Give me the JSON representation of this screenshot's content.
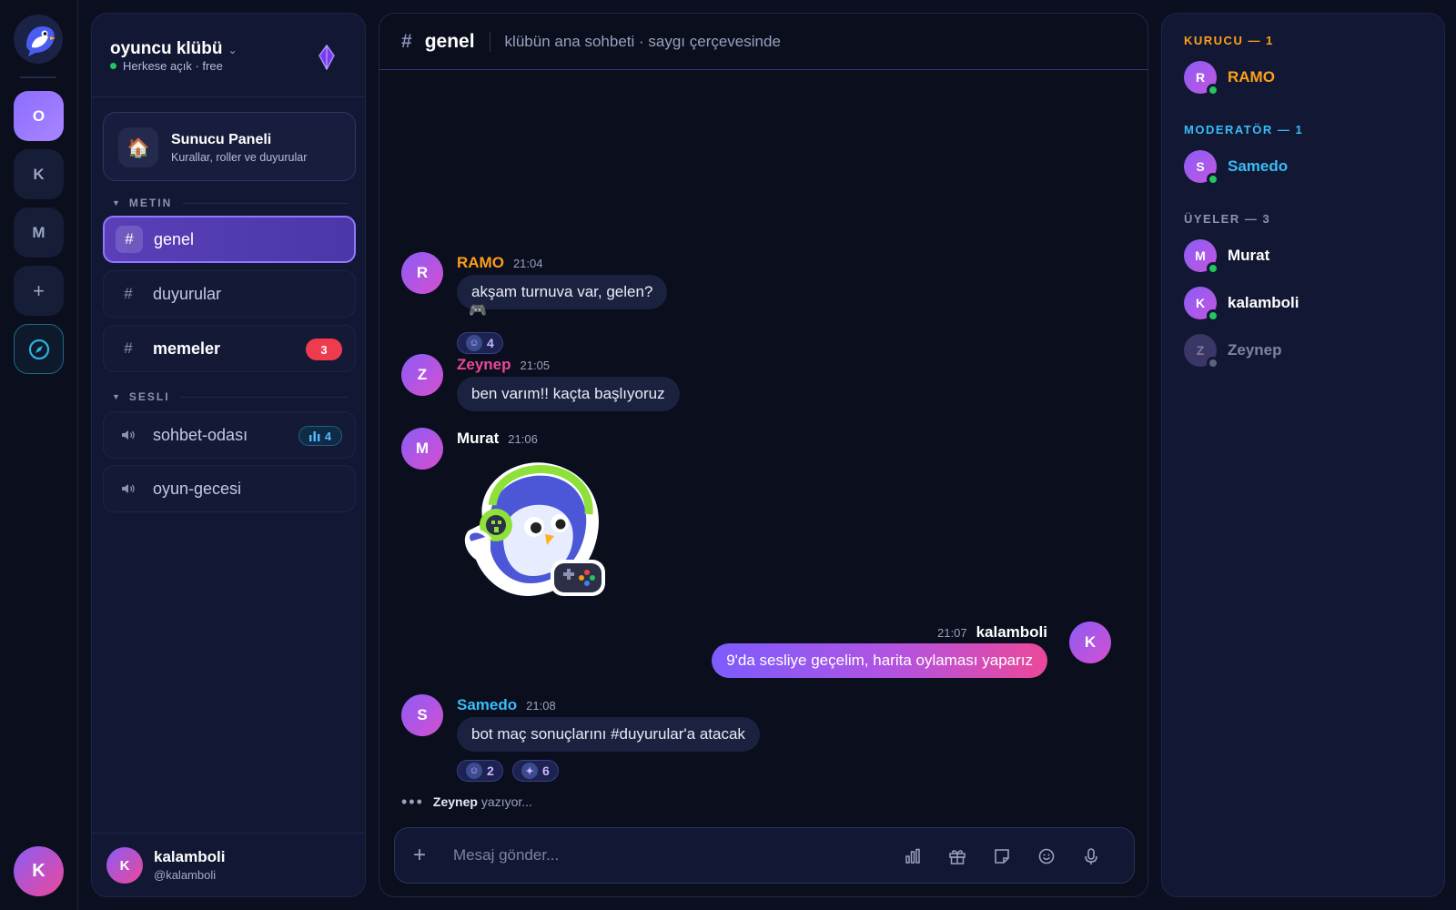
{
  "rail": {
    "servers": [
      {
        "label": "O",
        "active": true
      },
      {
        "label": "K",
        "active": false
      },
      {
        "label": "M",
        "active": false
      }
    ],
    "add_label": "+",
    "user_initial": "K"
  },
  "server": {
    "name": "oyuncu klübü",
    "status": "Herkese açık · free"
  },
  "panel_card": {
    "icon": "🏠",
    "title": "Sunucu Paneli",
    "subtitle": "Kurallar, roller ve duyurular"
  },
  "categories": {
    "text": "METIN",
    "voice": "SESLI"
  },
  "text_channels": [
    {
      "name": "genel",
      "active": true
    },
    {
      "name": "duyurular",
      "active": false
    },
    {
      "name": "memeler",
      "active": false,
      "unread": "3"
    }
  ],
  "voice_channels": [
    {
      "name": "sohbet-odası",
      "count": "4"
    },
    {
      "name": "oyun-gecesi"
    }
  ],
  "user": {
    "initial": "K",
    "name": "kalamboli",
    "handle": "@kalamboli"
  },
  "chat": {
    "hash": "#",
    "channel": "genel",
    "topic": "klübün ana sohbeti · saygı çerçevesinde",
    "messages": [
      {
        "initial": "R",
        "user": "RAMO",
        "time": "21:04",
        "text": "akşam turnuva var, gelen?",
        "emoji": "🎮",
        "reactions": [
          {
            "icon": "sticker-icon",
            "count": "4"
          }
        ],
        "color": "#ff9f1a"
      },
      {
        "initial": "Z",
        "user": "Zeynep",
        "time": "21:05",
        "text": "ben varım!! kaçta başlıyoruz",
        "color": "#ec4899"
      },
      {
        "initial": "M",
        "user": "Murat",
        "time": "21:06",
        "sticker": "gamer-bird-sticker",
        "color": "#ffffff"
      },
      {
        "initial": "K",
        "user": "kalamboli",
        "time": "21:07",
        "text": "9'da sesliye geçelim, harita oylaması yaparız",
        "color": "#ffffff"
      },
      {
        "initial": "S",
        "user": "Samedo",
        "time": "21:08",
        "text": "bot maç sonuçlarını #duyurular'a atacak",
        "reactions": [
          {
            "icon": "sticker-icon",
            "count": "2"
          },
          {
            "icon": "bird-icon",
            "count": "6"
          }
        ],
        "color": "#38bdf8"
      }
    ],
    "typing_user": "Zeynep",
    "typing_text": "yazıyor..."
  },
  "composer": {
    "placeholder": "Mesaj gönder...",
    "tools": [
      "poll-icon",
      "gift-icon",
      "sticker-icon",
      "emoji-icon",
      "mic-icon"
    ]
  },
  "members": {
    "groups": [
      {
        "title": "KURUCU — 1",
        "color": "#ff9f1a",
        "people": [
          {
            "initial": "R",
            "name": "RAMO",
            "online": true
          }
        ]
      },
      {
        "title": "MODERATÖR — 1",
        "color": "#38bdf8",
        "people": [
          {
            "initial": "S",
            "name": "Samedo",
            "online": true
          }
        ]
      },
      {
        "title": "ÜYELER — 3",
        "color": "#8a93b5",
        "people": [
          {
            "initial": "M",
            "name": "Murat",
            "online": true
          },
          {
            "initial": "K",
            "name": "kalamboli",
            "online": true
          },
          {
            "initial": "Z",
            "name": "Zeynep",
            "online": false
          }
        ]
      }
    ]
  }
}
